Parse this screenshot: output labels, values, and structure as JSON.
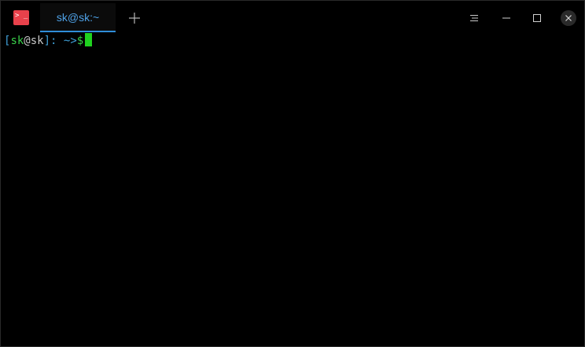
{
  "window": {
    "app_icon_glyph": "> _",
    "tab_title": "sk@sk:~",
    "accent_color": "#2f8dd8",
    "icon_color": "#e8414b",
    "buttons": {
      "new_tab": "plus-icon",
      "menu": "hamburger-icon",
      "minimize": "minimize-icon",
      "maximize": "maximize-icon",
      "close": "close-icon"
    }
  },
  "terminal": {
    "prompt": {
      "open_bracket": "[",
      "user": "sk",
      "at": "@",
      "host": "sk",
      "close_bracket": "]",
      "colon": ":",
      "space": " ",
      "path": "~>",
      "dollar": "$"
    }
  }
}
